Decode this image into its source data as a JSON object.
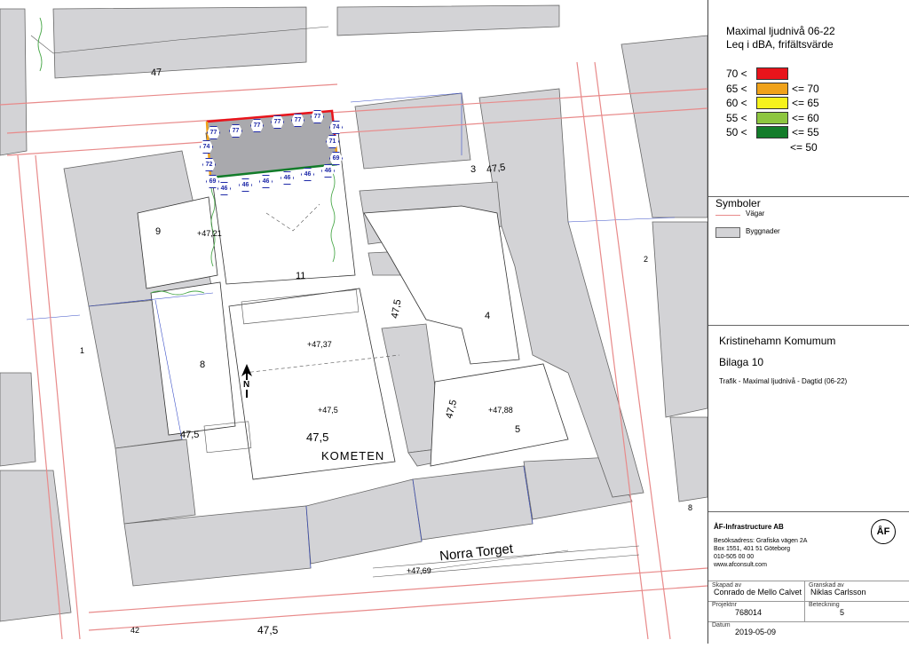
{
  "map": {
    "block_numbers": [
      "3",
      "4",
      "5",
      "8",
      "9",
      "11"
    ],
    "heights": [
      "47,5",
      "47,5",
      "47,5",
      "47,5",
      "47,5",
      "47,5",
      "47,5",
      "47"
    ],
    "spot_heights": [
      "+47,21",
      "+47,37",
      "+47,5",
      "+47,88",
      "+47,69"
    ],
    "street_name": "Norra Torget",
    "block_name": "KOMETEN",
    "edge_numbers": [
      "1",
      "2",
      "8",
      "42"
    ],
    "north_label": "N",
    "top_facade_values": [
      "77",
      "77",
      "77",
      "77",
      "77",
      "77",
      "77"
    ],
    "corner_values": [
      "74",
      "74",
      "72",
      "69",
      "71",
      "69"
    ],
    "bottom_facade_values": [
      "46",
      "46",
      "46",
      "46",
      "46",
      "46",
      "46"
    ]
  },
  "legend": {
    "title_line1": "Maximal ljudnivå 06-22",
    "title_line2": "Leq i dBA, frifältsvärde",
    "classes": [
      {
        "left": "70 <",
        "right": "",
        "color": "#e8141b"
      },
      {
        "left": "65 <",
        "right": "<= 70",
        "color": "#f0a21a"
      },
      {
        "left": "60 <",
        "right": "<= 65",
        "color": "#f6f21c"
      },
      {
        "left": "55 <",
        "right": "<= 60",
        "color": "#8dc63f"
      },
      {
        "left": "50 <",
        "right": "<= 55",
        "color": "#137c2a"
      },
      {
        "left": "",
        "right": "<= 50",
        "color": ""
      }
    ]
  },
  "symbols": {
    "title": "Symboler",
    "road_label": "Vägar",
    "road_color": "#e88a8a",
    "building_label": "Byggnader",
    "building_color": "#d3d3d6"
  },
  "project": {
    "name": "Kristinehamn Komumum",
    "appendix": "Bilaga 10",
    "description": "Trafik -  Maximal ljudnivå - Dagtid (06-22)"
  },
  "company": {
    "name": "ÅF-Infrastructure AB",
    "address1": "Besöksadress: Grafiska vägen 2A",
    "address2": "Box 1551, 401 51  Göteborg",
    "phone": "010-505 00 00",
    "web": "www.afconsult.com",
    "logo_text": "ÅF"
  },
  "titleblock": {
    "created_by_label": "Skapad av",
    "created_by": "Conrado de Mello Calvet",
    "reviewed_by_label": "Granskad av",
    "reviewed_by": "Niklas Carlsson",
    "project_label": "Projektnr",
    "project_no": "768014",
    "appendix_label": "Beteckning",
    "appendix_no": "5",
    "date_label": "Datum",
    "date": "2019-05-09"
  }
}
